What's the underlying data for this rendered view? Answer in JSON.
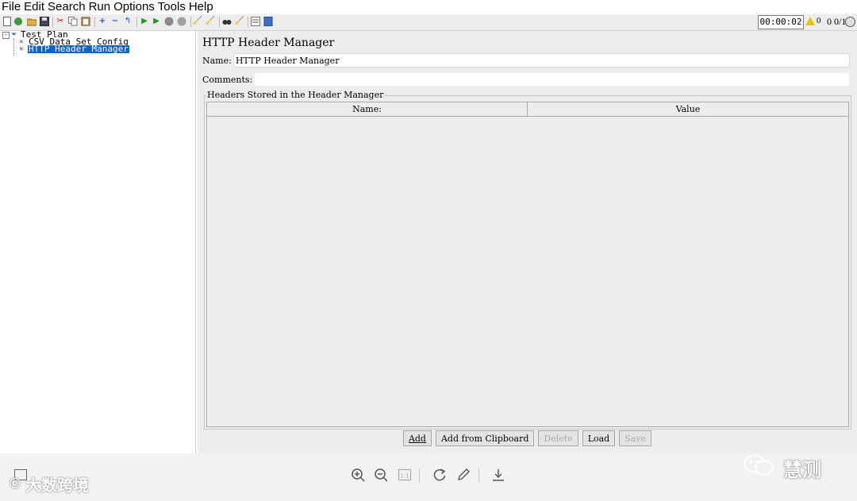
{
  "menu": [
    "File",
    "Edit",
    "Search",
    "Run",
    "Options",
    "Tools",
    "Help"
  ],
  "toolbar": {
    "timer": "00:00:02",
    "warnings": "0",
    "threads": "0 0/1"
  },
  "tree": {
    "items": [
      {
        "label": "Test Plan"
      },
      {
        "label": "CSV Data Set Config"
      },
      {
        "label": "HTTP Header Manager"
      }
    ]
  },
  "main": {
    "title": "HTTP Header Manager",
    "name_label": "Name:",
    "name_value": "HTTP Header Manager",
    "comments_label": "Comments:",
    "comments_value": "",
    "group_title": "Headers Stored in the Header Manager",
    "columns": [
      "Name:",
      "Value"
    ],
    "buttons": [
      {
        "label": "Add",
        "enabled": true
      },
      {
        "label": "Add from Clipboard",
        "enabled": true
      },
      {
        "label": "Delete",
        "enabled": false
      },
      {
        "label": "Load",
        "enabled": true
      },
      {
        "label": "Save",
        "enabled": false
      }
    ]
  },
  "watermark": {
    "left": "大数跨境",
    "right": "慧测"
  }
}
